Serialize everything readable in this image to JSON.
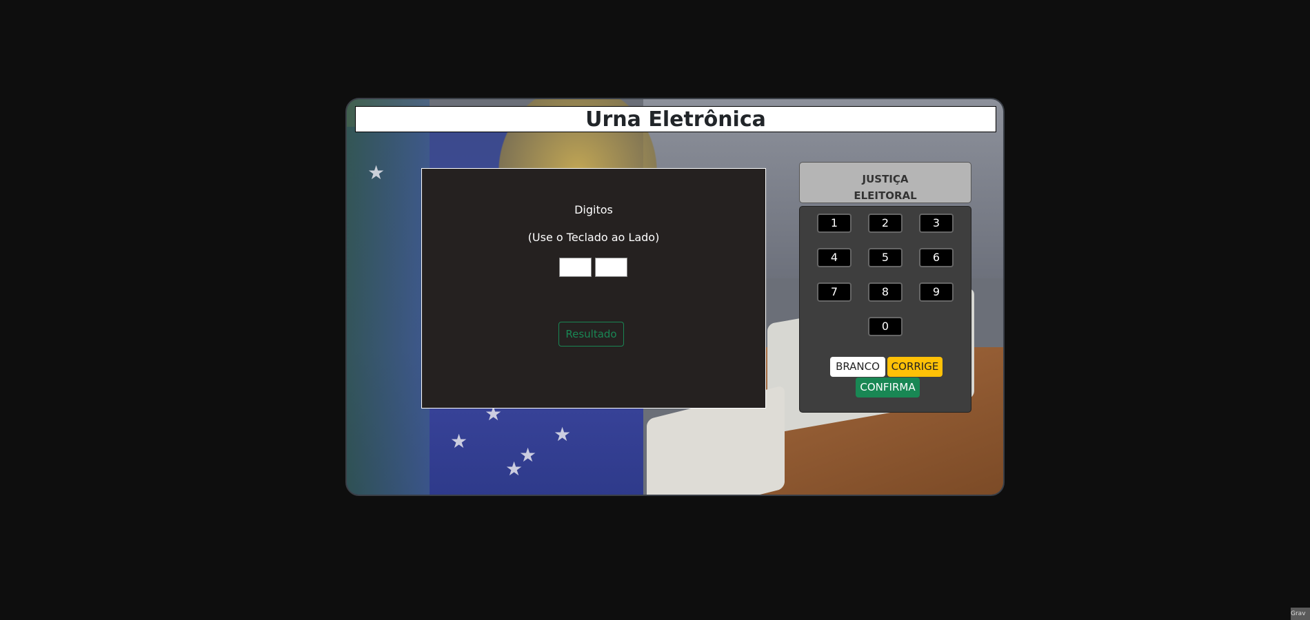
{
  "app": {
    "title": "Urna Eletrônica"
  },
  "screen": {
    "digitos_label": "Digitos",
    "hint": "(Use o Teclado ao Lado)",
    "digit_boxes": [
      "",
      ""
    ],
    "resultado_label": "Resultado"
  },
  "justica": {
    "line1": "JUSTIÇA",
    "line2": "ELEITORAL"
  },
  "keypad": {
    "keys": [
      "1",
      "2",
      "3",
      "4",
      "5",
      "6",
      "7",
      "8",
      "9",
      "0"
    ],
    "branco": "BRANCO",
    "corrige": "CORRIGE",
    "confirma": "CONFIRMA"
  },
  "corner": {
    "text": "Grav"
  },
  "colors": {
    "page_bg": "#0e0e0e",
    "screen_bg": "#252120",
    "keypad_bg": "#3e3e3e",
    "success": "#198754",
    "warning": "#ffc107"
  }
}
